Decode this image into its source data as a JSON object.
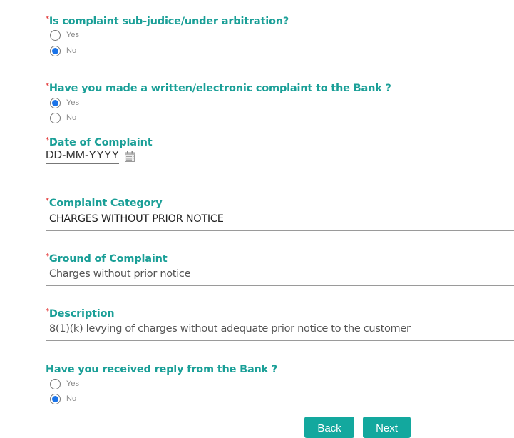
{
  "questions": {
    "sub_judice": {
      "label": "Is complaint sub-judice/under arbitration?",
      "required_mark": "*",
      "options": [
        {
          "label": "Yes",
          "checked": false
        },
        {
          "label": "No",
          "checked": true
        }
      ]
    },
    "written_complaint": {
      "label": "Have you made a written/electronic complaint to the Bank ?",
      "required_mark": "*",
      "options": [
        {
          "label": "Yes",
          "checked": true
        },
        {
          "label": "No",
          "checked": false
        }
      ]
    },
    "date_of_complaint": {
      "label": "Date of Complaint",
      "required_mark": "*",
      "placeholder": "DD-MM-YYYY",
      "icon": "calendar-icon"
    },
    "complaint_category": {
      "label": "Complaint Category",
      "required_mark": "*",
      "value": "CHARGES WITHOUT PRIOR NOTICE"
    },
    "ground_of_complaint": {
      "label": "Ground of Complaint",
      "required_mark": "*",
      "value": "Charges without prior notice"
    },
    "description": {
      "label": "Description",
      "required_mark": "*",
      "value": "8(1)(k) levying of charges without adequate prior notice to the customer"
    },
    "received_reply": {
      "label": "Have you received reply from the Bank ?",
      "options": [
        {
          "label": "Yes",
          "checked": false
        },
        {
          "label": "No",
          "checked": true
        }
      ]
    }
  },
  "buttons": {
    "back": "Back",
    "next": "Next"
  },
  "colors": {
    "accent": "#1a9f97",
    "button": "#13a89e",
    "required": "#e02020",
    "radio_checked": "#1a73e8"
  }
}
